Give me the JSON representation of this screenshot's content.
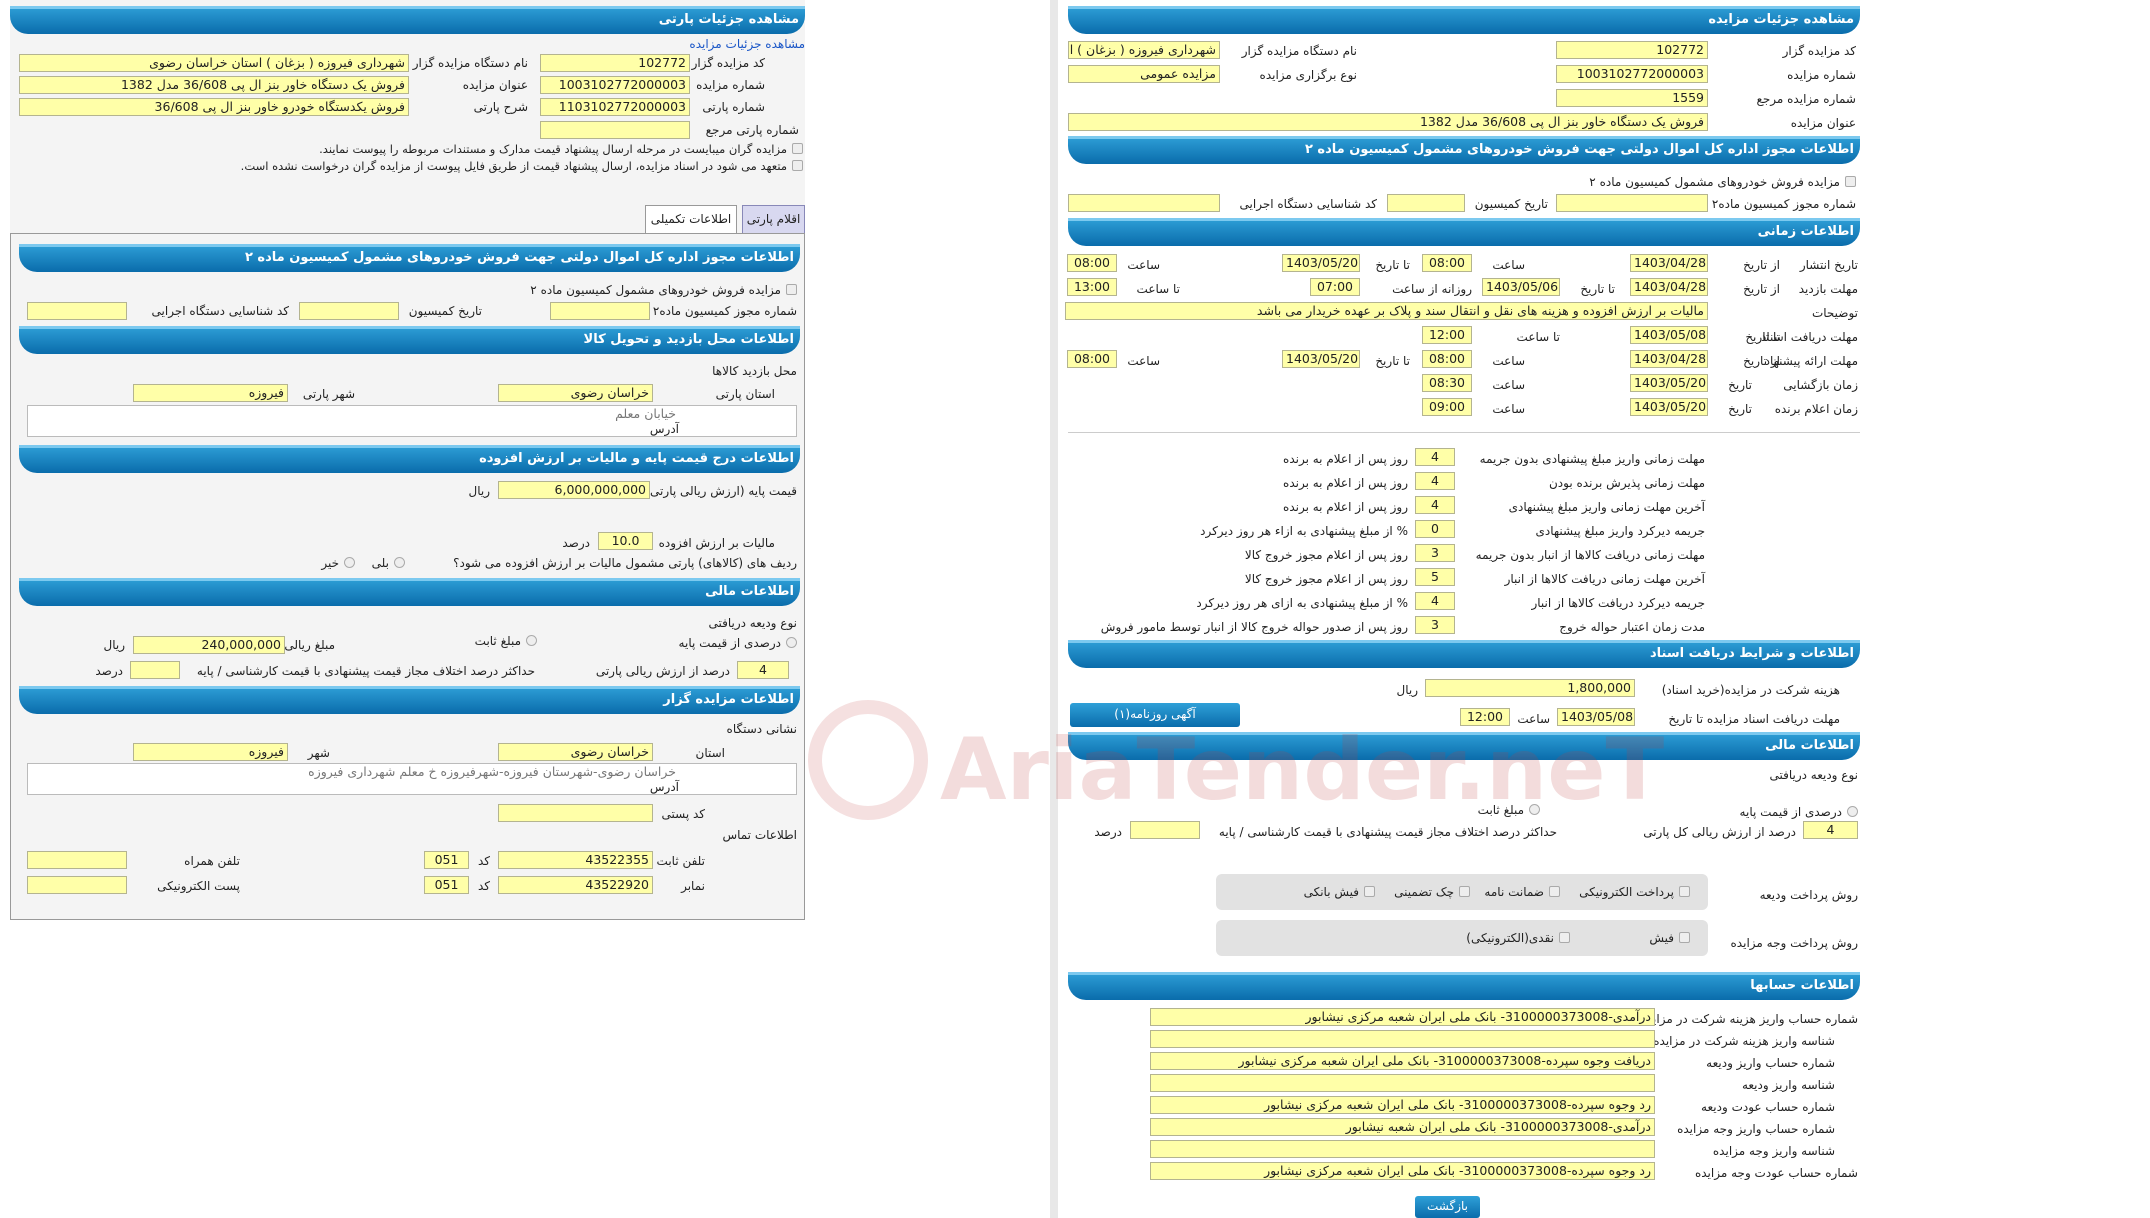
{
  "left": {
    "title": "مشاهده جزئیات پارتی",
    "link": "مشاهده جزئیات مزایده",
    "l_code": "کد مزایده گزار",
    "v_code": "102772",
    "l_org": "نام دستگاه مزایده گزار",
    "v_org": "شهرداری فیروزه ( بزغان ) استان خراسان رضوی",
    "l_aucnum": "شماره مزایده",
    "v_aucnum": "1003102772000003",
    "l_auctitle": "عنوان مزایده",
    "v_auctitle": "فروش یک دستگاه خاور بنز ال پی 36/608 مدل 1382",
    "l_partynum": "شماره پارتی",
    "v_partynum": "1103102772000003",
    "l_partydesc": "شرح پارتی",
    "v_partydesc": "فروش یکدستگاه خودرو خاور بنز ال پی 36/608",
    "l_ref": "شماره پارتی مرجع",
    "note1": "مزایده گران میبایست در مرحله ارسال پیشنهاد قیمت مدارک و مستندات مربوطه را پیوست نمایند.",
    "note2": "متعهد می شود در اسناد مزایده، ارسال پیشنهاد قیمت از طریق فایل پیوست از مزایده گران درخواست نشده است.",
    "tab1": "اقلام پارتی",
    "tab2": "اطلاعات تکمیلی",
    "h_permit": "اطلاعات مجوز اداره کل اموال دولتی جهت فروش خودروهای مشمول کمیسیون ماده ۲",
    "permit_cb": "مزایده فروش خودروهای مشمول کمیسیون ماده ۲",
    "l_permitno": "شماره مجوز کمیسیون ماده۲",
    "l_permitdate": "تاریخ کمیسیون",
    "l_execid": "کد شناسایی دستگاه اجرایی",
    "h_visit": "اطلاعات محل بازدید و تحویل کالا",
    "l_visitplace": "محل بازدید کالاها",
    "l_prov": "استان پارتی",
    "v_prov": "خراسان رضوی",
    "l_city": "شهر پارتی",
    "v_city": "فیروزه",
    "l_addr": "آدرس",
    "v_addr": "خیابان معلم",
    "h_price": "اطلاعات درج قیمت پایه و مالیات بر ارزش افزوده",
    "l_base": "قیمت پایه (ارزش ریالی پارتی)",
    "v_base": "6,000,000,000",
    "u_rial": "ریال",
    "l_vat": "مالیات بر ارزش افزوده",
    "v_vat": "10.0",
    "u_pct": "درصد",
    "l_vatq": "ردیف های (کالاهای) پارتی مشمول مالیات بر ارزش افزوده می شود؟",
    "yes": "بلی",
    "no": "خیر",
    "h_fin": "اطلاعات مالی",
    "l_deptype": "نوع ودیعه دریافتی",
    "l_pctbase": "درصدی از قیمت پایه",
    "l_fixed": "مبلغ ثابت",
    "l_depamt": "مبلغ ریالی ودیعه",
    "v_depamt": "240,000,000",
    "v_pct": "4",
    "l_pctof": "درصد از ارزش ریالی پارتی",
    "l_maxdiff": "حداکثر درصد اختلاف مجاز قیمت پیشنهادی با قیمت کارشناسی / پایه",
    "h_org": "اطلاعات مزایده گزار",
    "l_orgaddr": "نشانی دستگاه",
    "l_oprov": "استان",
    "v_oprov": "خراسان رضوی",
    "l_ocity": "شهر",
    "v_ocity": "فیروزه",
    "l_oaddr": "آدرس",
    "v_oaddr": "خراسان رضوی-شهرستان فیروزه-شهرفیروزه خ معلم  شهرداری فیروزه",
    "l_zip": "کد پستی",
    "l_contact": "اطلاعات تماس",
    "l_tel": "تلفن ثابت",
    "v_tel": "43522355",
    "l_code2": "کد",
    "v_telcode": "051",
    "l_mobile": "تلفن همراه",
    "l_fax": "نمابر",
    "v_fax": "43522920",
    "v_faxcode": "051",
    "l_email": "پست الکترونیکی"
  },
  "right": {
    "title": "مشاهده جزئیات مزایده",
    "l_code": "کد مزایده گزار",
    "v_code": "102772",
    "l_org": "نام دستگاه مزایده گزار",
    "v_org": "شهرداری فیروزه ( بزغان ) ا",
    "l_aucnum": "شماره مزایده",
    "v_aucnum": "1003102772000003",
    "l_type": "نوع برگزاری مزایده",
    "v_type": "مزایده عمومی",
    "l_ref": "شماره مزایده مرجع",
    "v_ref": "1559",
    "l_title": "عنوان مزایده",
    "v_title": "فروش یک دستگاه خاور بنز ال پی 36/608 مدل 1382",
    "h_permit": "اطلاعات مجوز اداره کل اموال دولتی جهت فروش خودروهای مشمول کمیسیون ماده ۲",
    "permit_cb": "مزایده فروش خودروهای مشمول کمیسیون ماده ۲",
    "l_permitno": "شماره مجوز کمیسیون ماده۲",
    "l_permitdate": "تاریخ کمیسیون",
    "l_execid": "کد شناسایی دستگاه اجرایی",
    "h_time": "اطلاعات زمانی",
    "l_pub": "تاریخ انتشار",
    "l_visit": "مهلت بازدید",
    "l_desc": "توضیحات",
    "l_docs": "مهلت دریافت اسناد",
    "l_offer": "مهلت ارائه پیشنهاد",
    "l_open": "زمان بازگشایی",
    "l_winner": "زمان اعلام برنده",
    "from_date": "از تاریخ",
    "to_date": "تا تاریخ",
    "date_lbl": "تاریخ",
    "hour": "ساعت",
    "to_hour": "تا ساعت",
    "daily_from": "روزانه از ساعت",
    "pub_from": "1403/04/28",
    "pub_fh": "08:00",
    "pub_to": "1403/05/20",
    "pub_th": "08:00",
    "vis_from": "1403/04/28",
    "vis_to": "1403/05/06",
    "vis_h1": "07:00",
    "vis_h2": "13:00",
    "desc": "مالیات بر ارزش افزوده و هزینه های نقل و انتقال سند و پلاک بر عهده خریدار می باشد",
    "docs_to": "1403/05/08",
    "docs_h": "12:00",
    "off_from": "1403/04/28",
    "off_fh": "08:00",
    "off_to": "1403/05/20",
    "off_th": "08:00",
    "open_d": "1403/05/20",
    "open_h": "08:30",
    "win_d": "1403/05/20",
    "win_h": "09:00",
    "d1_l": "مهلت زمانی واریز مبلغ پیشنهادی بدون جریمه",
    "d1_v": "4",
    "d1_u": "روز پس از اعلام به برنده",
    "d2_l": "مهلت زمانی پذیرش برنده بودن",
    "d2_v": "4",
    "d2_u": "روز پس از اعلام به برنده",
    "d3_l": "آخرین مهلت زمانی واریز مبلغ پیشنهادی",
    "d3_v": "4",
    "d3_u": "روز پس از اعلام به برنده",
    "d4_l": "جریمه دیرکرد واریز مبلغ پیشنهادی",
    "d4_v": "0",
    "d4_u": "% از مبلغ پیشنهادی به ازاء هر روز دیرکرد",
    "d5_l": "مهلت زمانی دریافت کالاها از انبار بدون جریمه",
    "d5_v": "3",
    "d5_u": "روز پس از اعلام مجوز خروج کالا",
    "d6_l": "آخرین مهلت زمانی دریافت کالاها از انبار",
    "d6_v": "5",
    "d6_u": "روز پس از اعلام مجوز خروج کالا",
    "d7_l": "جریمه دیرکرد دریافت کالاها از انبار",
    "d7_v": "4",
    "d7_u": "% از مبلغ پیشنهادی به ازای هر روز دیرکرد",
    "d8_l": "مدت زمان اعتبار حواله خروج",
    "d8_v": "3",
    "d8_u": "روز پس از صدور حواله خروج کالا از انبار توسط مامور فروش",
    "h_docs": "اطلاعات و شرایط دریافت اسناد",
    "l_fee": "هزینه شرکت در مزایده(خرید اسناد)",
    "v_fee": "1,800,000",
    "u_rial": "ریال",
    "l_docdl": "مهلت دریافت اسناد مزایده تا تاریخ",
    "v_docdl": "1403/05/08",
    "v_dochr": "12:00",
    "ad_btn": "آگهی روزنامه(۱)",
    "h_fin": "اطلاعات مالی",
    "l_deptype": "نوع ودیعه دریافتی",
    "l_pctbase": "درصدی از قیمت پایه",
    "l_fixed": "مبلغ ثابت",
    "v_pct": "4",
    "l_pctof": "درصد از ارزش ریالی کل پارتی",
    "l_maxdiff": "حداکثر درصد اختلاف مجاز قیمت پیشنهادی با قیمت کارشناسی / پایه",
    "u_pct": "درصد",
    "l_paydep": "روش پرداخت ودیعه",
    "pay1": "پرداخت الکترونیکی",
    "pay2": "ضمانت نامه",
    "pay3": "چک تضمینی",
    "pay4": "فیش بانکی",
    "l_paybid": "روش پرداخت وجه مزایده",
    "bid1": "فیش",
    "bid2": "نقدی(الکترونیکی)",
    "h_acc": "اطلاعات حسابها",
    "a1_l": "شماره حساب واریز هزینه شرکت در مزایده",
    "a1_v": "درآمدی-3100000373008- بانک ملی ایران شعبه مرکزی نیشابور",
    "a2_l": "شناسه واریز هزینه شرکت در مزایده",
    "a3_l": "شماره حساب واریز ودیعه",
    "a3_v": "دریافت وجوه سپرده-3100000373008- بانک ملی ایران شعبه مرکزی نیشابور",
    "a4_l": "شناسه واریز ودیعه",
    "a5_l": "شماره حساب عودت ودیعه",
    "a5_v": "رد وجوه سپرده-3100000373008- بانک ملی ایران شعبه مرکزی نیشابور",
    "a6_l": "شماره حساب واریز وجه مزایده",
    "a6_v": "درآمدی-3100000373008- بانک ملی ایران شعبه نیشابور",
    "a7_l": "شناسه واریز وجه مزایده",
    "a8_l": "شماره حساب عودت وجه مزایده",
    "a8_v": "رد وجوه سپرده-3100000373008- بانک ملی ایران شعبه مرکزی نیشابور",
    "back": "بازگشت"
  },
  "watermark": "AriaTender.neT"
}
